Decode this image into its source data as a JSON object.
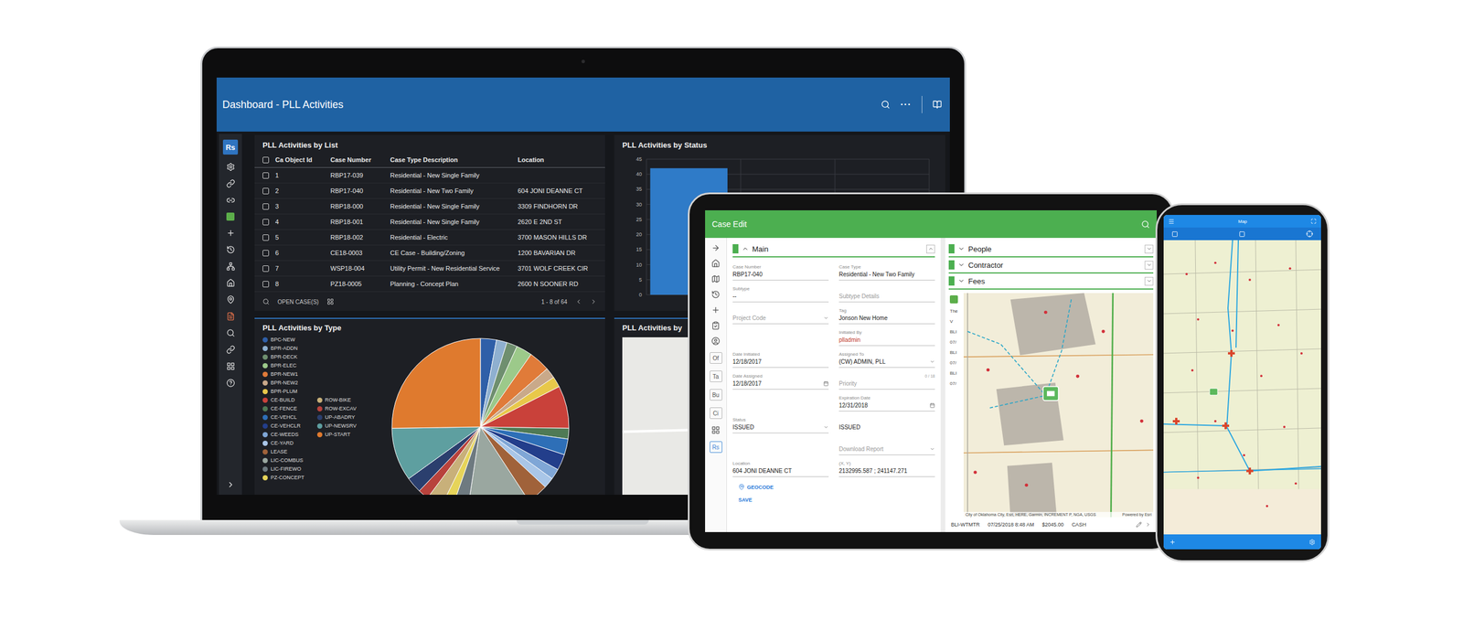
{
  "laptop": {
    "header": {
      "title": "Dashboard - PLL Activities",
      "more": "···"
    },
    "sidebar": {
      "logo": "Rs",
      "logo_selected": true
    },
    "table": {
      "title": "PLL Activities by List",
      "all_checked": false,
      "columns": [
        "Ca Object Id",
        "Case Number",
        "Case Type Description",
        "Location"
      ],
      "rows": [
        {
          "id": "1",
          "case": "RBP17-039",
          "type": "Residential - New Single Family",
          "location": "",
          "checked": false
        },
        {
          "id": "2",
          "case": "RBP17-040",
          "type": "Residential - New Two Family",
          "location": "604 JONI DEANNE CT",
          "checked": false
        },
        {
          "id": "3",
          "case": "RBP18-000",
          "type": "Residential - New Single Family",
          "location": "3309 FINDHORN DR",
          "checked": false
        },
        {
          "id": "4",
          "case": "RBP18-001",
          "type": "Residential - New Single Family",
          "location": "2620 E 2ND ST",
          "checked": false
        },
        {
          "id": "5",
          "case": "RBP18-002",
          "type": "Residential - Electric",
          "location": "3700 MASON HILLS DR",
          "checked": false
        },
        {
          "id": "6",
          "case": "CE18-0003",
          "type": "CE Case - Building/Zoning",
          "location": "1200 BAVARIAN DR",
          "checked": false
        },
        {
          "id": "7",
          "case": "WSP18-004",
          "type": "Utility Permit - New Residential Service",
          "location": "3701 WOLF CREEK CIR",
          "checked": false
        },
        {
          "id": "8",
          "case": "PZ18-0005",
          "type": "Planning - Concept Plan",
          "location": "2600 N SOONER RD",
          "checked": false
        }
      ],
      "footer": {
        "action": "OPEN CASE(S)",
        "range": "1 - 8 of 64"
      }
    },
    "status_chart": {
      "title": "PLL Activities by Status",
      "ticks": [
        "0",
        "5",
        "10",
        "15",
        "20",
        "25",
        "30",
        "35",
        "40",
        "45"
      ],
      "values": [
        42,
        0,
        0
      ]
    },
    "type_chart": {
      "title": "PLL Activities by Type",
      "legend": [
        {
          "label": "BPC-NEW",
          "value": 3,
          "color": "#2f5fa8"
        },
        {
          "label": "BPR-ADDN",
          "value": 2,
          "color": "#8fb0d0"
        },
        {
          "label": "BPR-DECK",
          "value": 2,
          "color": "#6f8f6f"
        },
        {
          "label": "BPR-ELEC",
          "value": 3,
          "color": "#9cc98a"
        },
        {
          "label": "BPR-NEW1",
          "value": 4,
          "color": "#e07b39"
        },
        {
          "label": "BPR-NEW2",
          "value": 2,
          "color": "#c9a98a"
        },
        {
          "label": "BPR-PLUM",
          "value": 2,
          "color": "#e8c84a"
        },
        {
          "label": "CE-BUILD",
          "value": 8,
          "color": "#c9413a"
        },
        {
          "label": "CE-FENCE",
          "value": 2,
          "color": "#4f7a55"
        },
        {
          "label": "CE-VEHCL",
          "value": 3,
          "color": "#2e6fb7"
        },
        {
          "label": "CE-VEHCLR",
          "value": 3,
          "color": "#233e8b"
        },
        {
          "label": "CE-WEEDS",
          "value": 2,
          "color": "#7fa6d6"
        },
        {
          "label": "CE-YARD",
          "value": 2,
          "color": "#a9c6e8"
        },
        {
          "label": "LEASE",
          "value": 4,
          "color": "#a0623a"
        },
        {
          "label": "LIC-COMBUS",
          "value": 12,
          "color": "#9aa7a0"
        },
        {
          "label": "LIC-FIREWO",
          "value": 3,
          "color": "#6e7a80"
        },
        {
          "label": "PZ-CONCEPT",
          "value": 2,
          "color": "#e6d45a"
        },
        {
          "label": "ROW-BIKE",
          "value": 3,
          "color": "#c8b07a"
        },
        {
          "label": "ROW-EXCAV",
          "value": 2,
          "color": "#b8423c"
        },
        {
          "label": "UP-ABADRY",
          "value": 3,
          "color": "#2b3f6e"
        },
        {
          "label": "UP-NEWSRV",
          "value": 10,
          "color": "#5e9fa0"
        },
        {
          "label": "UP-START",
          "value": 26,
          "color": "#df7a2e"
        }
      ]
    },
    "map_panel": {
      "title": "PLL Activities by"
    }
  },
  "tablet": {
    "header": {
      "title": "Case Edit"
    },
    "rail_buttons": [
      {
        "label": "Of",
        "selected": false
      },
      {
        "label": "Ta",
        "selected": false
      },
      {
        "label": "Bu",
        "selected": false
      },
      {
        "label": "Ci",
        "selected": false
      },
      {
        "label": "Rs",
        "selected": true
      }
    ],
    "main": {
      "title": "Main",
      "expanded": true,
      "rows": [
        [
          {
            "label": "Case Number",
            "value": "RBP17-040",
            "kind": "text"
          },
          {
            "label": "Case Type",
            "value": "Residential - New Two Family",
            "kind": "text"
          }
        ],
        [
          {
            "label": "Subtype",
            "value": "--",
            "kind": "text"
          },
          {
            "placeholder": "Subtype Details",
            "kind": "empty"
          }
        ],
        [
          {
            "placeholder": "Project Code",
            "kind": "empty-select"
          },
          {
            "label": "Tag",
            "value": "Jonson New Home",
            "kind": "text"
          }
        ],
        [
          null,
          {
            "label": "Initiated By",
            "value": "plladmin",
            "kind": "link"
          }
        ],
        [
          {
            "label": "Date Initiated",
            "value": "12/18/2017",
            "kind": "text"
          },
          {
            "label": "Assigned To",
            "value": "(CW) ADMIN, PLL",
            "kind": "select"
          }
        ],
        [
          {
            "label": "Date Assigned",
            "value": "12/18/2017",
            "kind": "date"
          },
          {
            "placeholder": "Priority",
            "kind": "empty",
            "counter": "0 / 18"
          }
        ],
        [
          null,
          {
            "label": "Expiration Date",
            "value": "12/31/2018",
            "kind": "date"
          }
        ],
        [
          {
            "label": "Status",
            "value": "ISSUED",
            "kind": "select"
          },
          {
            "value": "ISSUED",
            "kind": "plain"
          }
        ],
        [
          null,
          {
            "placeholder": "Download Report",
            "kind": "empty-select"
          }
        ],
        [
          {
            "label": "Location",
            "value": "604 JONI DEANNE CT",
            "kind": "text"
          },
          {
            "label": "(X, Y)",
            "value": "2132995.587 ; 241147.271",
            "kind": "text"
          }
        ]
      ],
      "geocode": "GEOCODE",
      "save": "SAVE"
    },
    "sections": [
      {
        "title": "People",
        "expanded": false
      },
      {
        "title": "Contractor",
        "expanded": false
      },
      {
        "title": "Fees",
        "expanded": false
      }
    ],
    "fees_partial": [
      "The",
      "V",
      "BLI",
      "07/",
      "BLI",
      "07/",
      "BLI",
      "07/"
    ],
    "map_attribution": "City of Oklahoma City, Esri, HERE, Garmin, INCREMENT P, NGA, USGS",
    "map_powered": "Powered by Esri",
    "fee_row": {
      "code": "BLI-WTMTR",
      "date": "07/25/2018 8:48 AM",
      "amount": "$2045.00",
      "method": "CASH"
    }
  },
  "phone": {
    "title": "Map"
  }
}
